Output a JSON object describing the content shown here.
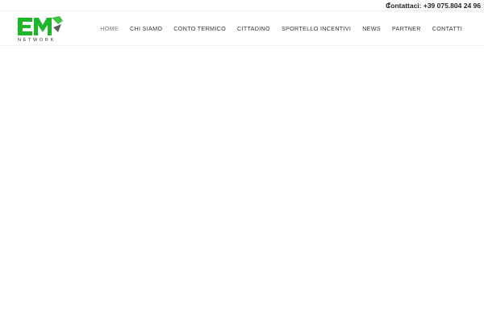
{
  "topbar": {
    "social_icon": "facebook-icon",
    "social_glyph": "f",
    "contact_text": "Contattaci: +39 075.804 24 96"
  },
  "logo": {
    "text": "EM",
    "subtext": "NETWORK",
    "color_main": "#1fb72a",
    "color_accent": "#333333"
  },
  "nav": {
    "items": [
      {
        "label": "HOME",
        "active": true
      },
      {
        "label": "CHI SIAMO"
      },
      {
        "label": "CONTO TERMICO"
      },
      {
        "label": "CITTADINO"
      },
      {
        "label": "SPORTELLO INCENTIVI"
      },
      {
        "label": "NEWS"
      },
      {
        "label": "PARTNER"
      },
      {
        "label": "CONTATTI"
      }
    ]
  }
}
